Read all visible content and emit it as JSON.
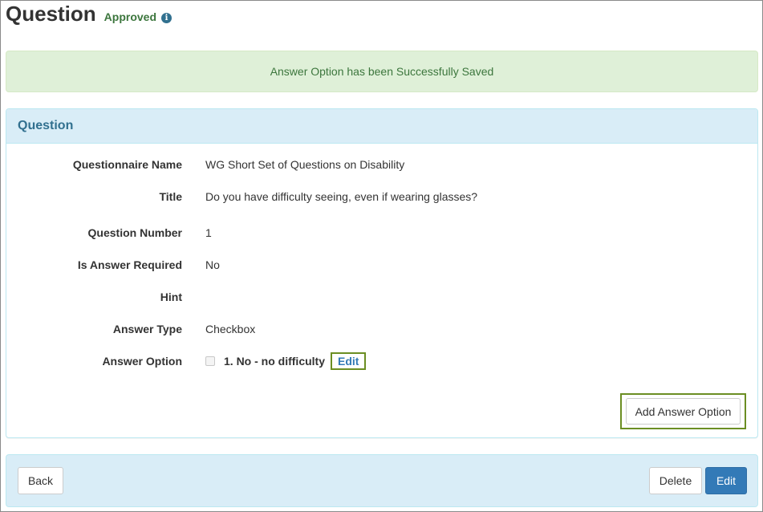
{
  "page": {
    "title": "Question",
    "status": "Approved",
    "info_icon_glyph": "i"
  },
  "alert": {
    "message": "Answer Option has been Successfully Saved"
  },
  "panel": {
    "heading": "Question",
    "fields": {
      "questionnaire_name": {
        "label": "Questionnaire Name",
        "value": "WG Short Set of Questions on Disability"
      },
      "title": {
        "label": "Title",
        "value": "Do you have difficulty seeing, even if wearing glasses?"
      },
      "question_number": {
        "label": "Question Number",
        "value": "1"
      },
      "is_answer_required": {
        "label": "Is Answer Required",
        "value": "No"
      },
      "hint": {
        "label": "Hint",
        "value": ""
      },
      "answer_type": {
        "label": "Answer Type",
        "value": "Checkbox"
      },
      "answer_option": {
        "label": "Answer Option",
        "option_text": "1. No - no difficulty",
        "edit_label": "Edit",
        "checked": false
      }
    },
    "add_answer_option_label": "Add Answer Option"
  },
  "footer": {
    "back_label": "Back",
    "delete_label": "Delete",
    "edit_label": "Edit"
  },
  "colors": {
    "success_text": "#3c763d",
    "success_bg": "#dff0d8",
    "info_bg": "#d9edf7",
    "info_text": "#31708f",
    "primary": "#337ab7",
    "highlight_outline": "#6b8e23"
  }
}
